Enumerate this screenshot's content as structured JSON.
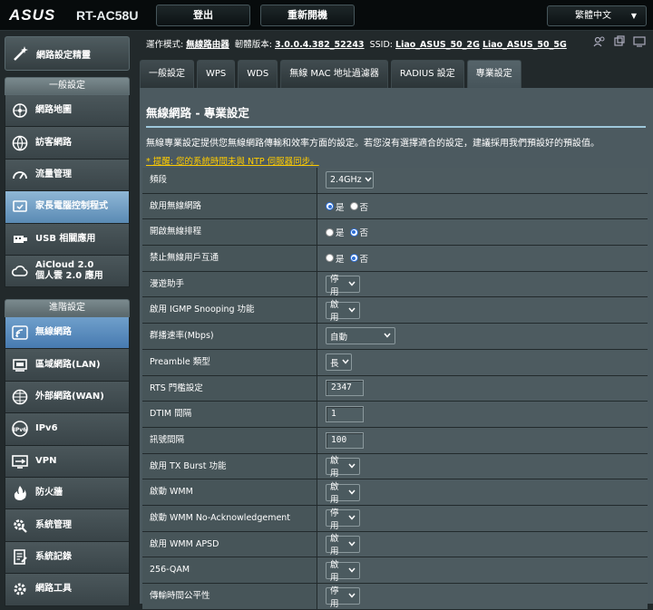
{
  "header": {
    "brand": "ASUS",
    "model": "RT-AC58U",
    "logout_label": "登出",
    "reboot_label": "重新開機",
    "language": "繁體中文"
  },
  "sidebar": {
    "quick_setup": "網路設定精靈",
    "general_header": "一般設定",
    "general_items": [
      {
        "label": "網路地圖",
        "icon": "network-map-icon"
      },
      {
        "label": "訪客網路",
        "icon": "guest-network-icon"
      },
      {
        "label": "流量管理",
        "icon": "traffic-manager-icon"
      },
      {
        "label": "家長電腦控制程式",
        "icon": "parental-control-icon"
      },
      {
        "label": "USB 相關應用",
        "icon": "usb-icon"
      },
      {
        "label": "AiCloud 2.0\n個人雲 2.0 應用",
        "icon": "cloud-icon"
      }
    ],
    "advanced_header": "進階設定",
    "advanced_items": [
      {
        "label": "無線網路",
        "icon": "wireless-icon"
      },
      {
        "label": "區域網路(LAN)",
        "icon": "lan-icon"
      },
      {
        "label": "外部網路(WAN)",
        "icon": "wan-globe-icon"
      },
      {
        "label": "IPv6",
        "icon": "ipv6-icon"
      },
      {
        "label": "VPN",
        "icon": "vpn-icon"
      },
      {
        "label": "防火牆",
        "icon": "firewall-icon"
      },
      {
        "label": "系統管理",
        "icon": "administration-icon"
      },
      {
        "label": "系統記錄",
        "icon": "system-log-icon"
      },
      {
        "label": "網路工具",
        "icon": "network-tools-icon"
      }
    ]
  },
  "status_bar": {
    "mode_label": "運作模式:",
    "mode_value": "無線路由器",
    "firmware_label": "韌體版本:",
    "firmware_value": "3.0.0.4.382_52243",
    "ssid_label": "SSID:",
    "ssid_2g": "Liao_ASUS_50_2G",
    "ssid_5g": "Liao_ASUS_50_5G"
  },
  "tabs": [
    "一般設定",
    "WPS",
    "WDS",
    "無線 MAC 地址過濾器",
    "RADIUS 設定",
    "專業設定"
  ],
  "panel": {
    "title": "無線網路 - 專業設定",
    "description": "無線專業設定提供您無線網路傳輸和效率方面的設定。若您沒有選擇適合的設定，建議採用我們預設好的預設值。",
    "warning": "* 提醒: 您的系統時間未與 NTP 伺服器同步。"
  },
  "settings": [
    {
      "label": "頻段",
      "type": "select",
      "value": "2.4GHz"
    },
    {
      "label": "啟用無線網路",
      "type": "radio",
      "yes": "是",
      "no": "否",
      "selected": "yes"
    },
    {
      "label": "開啟無線排程",
      "type": "radio",
      "yes": "是",
      "no": "否",
      "selected": "no"
    },
    {
      "label": "禁止無線用戶互通",
      "type": "radio",
      "yes": "是",
      "no": "否",
      "selected": "no"
    },
    {
      "label": "漫遊助手",
      "type": "select",
      "value": "停用"
    },
    {
      "label": "啟用 IGMP Snooping 功能",
      "type": "select",
      "value": "啟用"
    },
    {
      "label": "群播速率(Mbps)",
      "type": "select",
      "value": "自動"
    },
    {
      "label": "Preamble 類型",
      "type": "select",
      "value": "長"
    },
    {
      "label": "RTS 門檻設定",
      "type": "input",
      "value": "2347"
    },
    {
      "label": "DTIM 間隔",
      "type": "input",
      "value": "1"
    },
    {
      "label": "訊號間隔",
      "type": "input",
      "value": "100"
    },
    {
      "label": "啟用 TX Burst 功能",
      "type": "select",
      "value": "啟用"
    },
    {
      "label": "啟動 WMM",
      "type": "select",
      "value": "啟用"
    },
    {
      "label": "啟動 WMM No-Acknowledgement",
      "type": "select",
      "value": "停用"
    },
    {
      "label": "啟用 WMM APSD",
      "type": "select",
      "value": "啟用"
    },
    {
      "label": "256-QAM",
      "type": "select",
      "value": "啟用"
    },
    {
      "label": "傳輸時間公平性",
      "type": "select",
      "value": "停用"
    }
  ]
}
